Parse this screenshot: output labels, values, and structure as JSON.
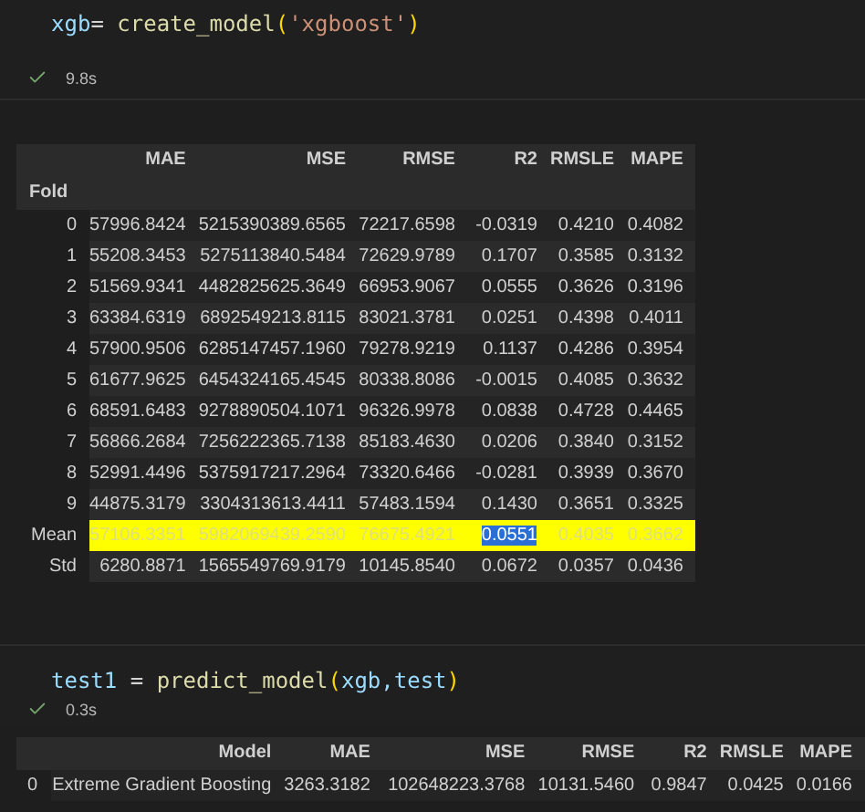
{
  "cells": [
    {
      "code": [
        {
          "kind": "variable",
          "text": "xgb"
        },
        {
          "kind": "operator",
          "text": "= "
        },
        {
          "kind": "function",
          "text": "create_model"
        },
        {
          "kind": "bracket",
          "text": "("
        },
        {
          "kind": "string",
          "text": "'xgboost'"
        },
        {
          "kind": "bracket",
          "text": ")"
        }
      ],
      "status": {
        "succeeded": true,
        "time": "9.8s"
      },
      "output": {
        "columns": [
          "MAE",
          "MSE",
          "RMSE",
          "R2",
          "RMSLE",
          "MAPE"
        ],
        "index_name": "Fold",
        "rows": [
          {
            "label": "0",
            "highlighted": false,
            "values": [
              "57996.8424",
              "5215390389.6565",
              "72217.6598",
              "-0.0319",
              "0.4210",
              "0.4082"
            ]
          },
          {
            "label": "1",
            "highlighted": false,
            "values": [
              "55208.3453",
              "5275113840.5484",
              "72629.9789",
              "0.1707",
              "0.3585",
              "0.3132"
            ]
          },
          {
            "label": "2",
            "highlighted": false,
            "values": [
              "51569.9341",
              "4482825625.3649",
              "66953.9067",
              "0.0555",
              "0.3626",
              "0.3196"
            ]
          },
          {
            "label": "3",
            "highlighted": false,
            "values": [
              "63384.6319",
              "6892549213.8115",
              "83021.3781",
              "0.0251",
              "0.4398",
              "0.4011"
            ]
          },
          {
            "label": "4",
            "highlighted": false,
            "values": [
              "57900.9506",
              "6285147457.1960",
              "79278.9219",
              "0.1137",
              "0.4286",
              "0.3954"
            ]
          },
          {
            "label": "5",
            "highlighted": false,
            "values": [
              "61677.9625",
              "6454324165.4545",
              "80338.8086",
              "-0.0015",
              "0.4085",
              "0.3632"
            ]
          },
          {
            "label": "6",
            "highlighted": false,
            "values": [
              "68591.6483",
              "9278890504.1071",
              "96326.9978",
              "0.0838",
              "0.4728",
              "0.4465"
            ]
          },
          {
            "label": "7",
            "highlighted": false,
            "values": [
              "56866.2684",
              "7256222365.7138",
              "85183.4630",
              "0.0206",
              "0.3840",
              "0.3152"
            ]
          },
          {
            "label": "8",
            "highlighted": false,
            "values": [
              "52991.4496",
              "5375917217.2964",
              "73320.6466",
              "-0.0281",
              "0.3939",
              "0.3670"
            ]
          },
          {
            "label": "9",
            "highlighted": false,
            "values": [
              "44875.3179",
              "3304313613.4411",
              "57483.1594",
              "0.1430",
              "0.3651",
              "0.3325"
            ]
          },
          {
            "label": "Mean",
            "highlighted": true,
            "values": [
              {
                "text": "57106.3351",
                "selected": false
              },
              {
                "text": "5982069439.2590",
                "selected": false
              },
              {
                "text": "76675.4921",
                "selected": false
              },
              {
                "text": "0.0551",
                "selected": true
              },
              {
                "text": "0.4035",
                "selected": false
              },
              {
                "text": "0.3662",
                "selected": false
              }
            ]
          },
          {
            "label": "Std",
            "highlighted": false,
            "values": [
              "6280.8871",
              "1565549769.9179",
              "10145.8540",
              "0.0672",
              "0.0357",
              "0.0436"
            ]
          }
        ]
      }
    },
    {
      "code": [
        {
          "kind": "variable",
          "text": "test1"
        },
        {
          "kind": "operator",
          "text": " = "
        },
        {
          "kind": "function",
          "text": "predict_model"
        },
        {
          "kind": "bracket",
          "text": "("
        },
        {
          "kind": "variable",
          "text": "xgb,test"
        },
        {
          "kind": "bracket",
          "text": ")"
        }
      ],
      "status": {
        "succeeded": true,
        "time": "0.3s"
      },
      "output": {
        "columns": [
          "Model",
          "MAE",
          "MSE",
          "RMSE",
          "R2",
          "RMSLE",
          "MAPE"
        ],
        "rows": [
          {
            "label": "0",
            "highlighted": false,
            "values": [
              "Extreme Gradient Boosting",
              "3263.3182",
              "102648223.3768",
              "10131.5460",
              "0.9847",
              "0.0425",
              "0.0166"
            ]
          }
        ]
      }
    }
  ]
}
